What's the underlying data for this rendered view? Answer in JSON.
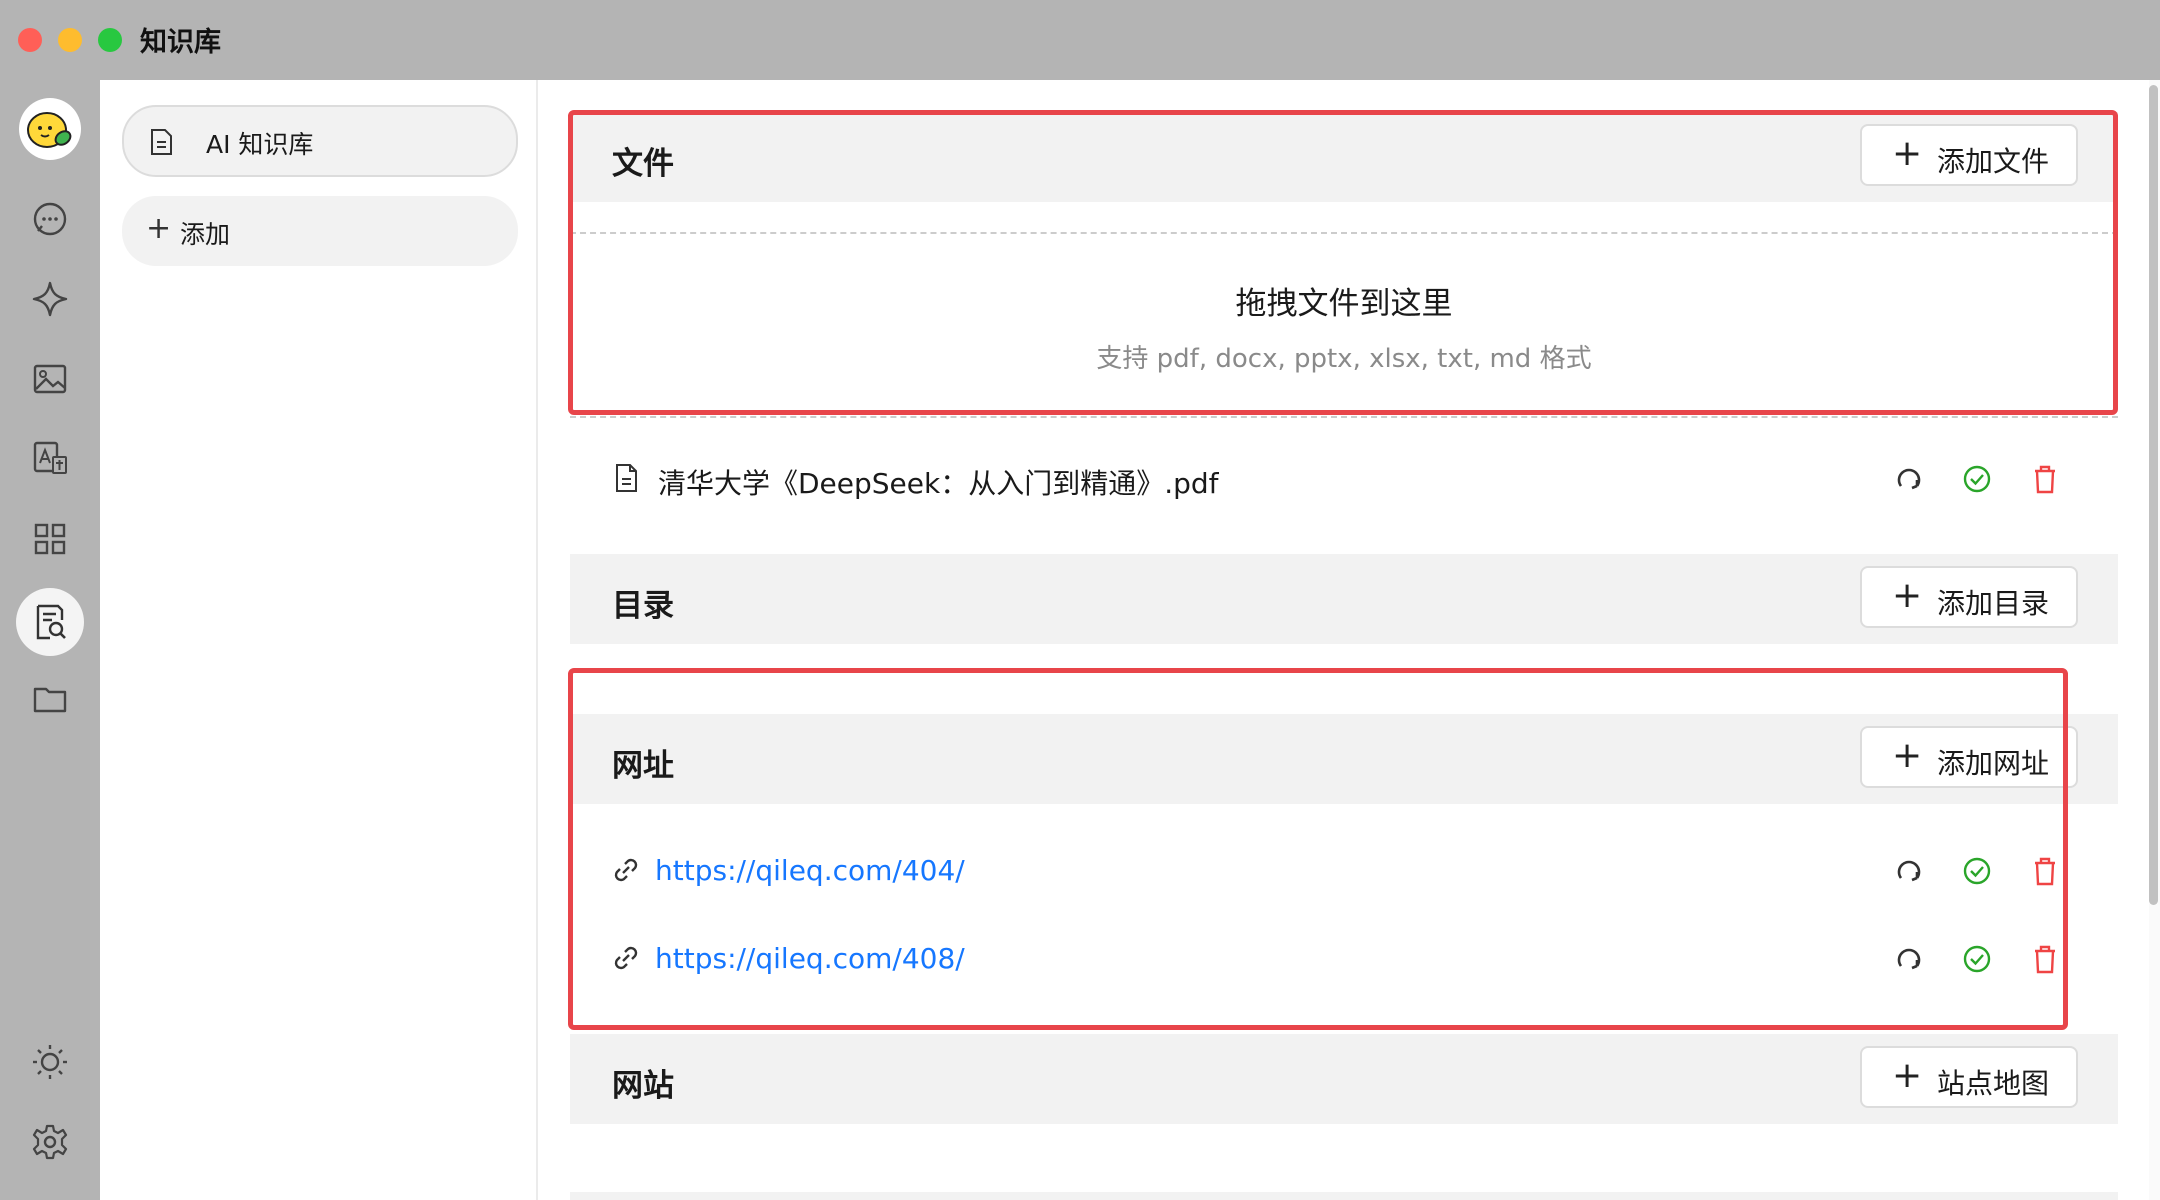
{
  "window": {
    "title": "知识库"
  },
  "sidebar_icons": [
    {
      "icon": "chat-bubble-icon"
    },
    {
      "icon": "sparkle-icon"
    },
    {
      "icon": "image-icon"
    },
    {
      "icon": "translate-icon"
    },
    {
      "icon": "apps-grid-icon"
    },
    {
      "icon": "knowledge-base-icon",
      "active": true
    },
    {
      "icon": "folder-icon"
    },
    {
      "icon": "theme-sun-icon"
    },
    {
      "icon": "settings-gear-icon"
    }
  ],
  "kb_list": {
    "items": [
      {
        "label": "AI 知识库",
        "icon": "document-icon"
      }
    ],
    "add_label": "添加"
  },
  "sections": {
    "files": {
      "title": "文件",
      "button": "添加文件",
      "drop_title": "拖拽文件到这里",
      "drop_hint": "支持 pdf, docx, pptx, xlsx, txt, md 格式",
      "items": [
        {
          "name": "清华大学《DeepSeek：从入门到精通》.pdf",
          "status": "processed"
        }
      ]
    },
    "directory": {
      "title": "目录",
      "button": "添加目录"
    },
    "urls": {
      "title": "网址",
      "button": "添加网址",
      "items": [
        {
          "url": "https://qileq.com/404/",
          "status": "processed"
        },
        {
          "url": "https://qileq.com/408/",
          "status": "processed"
        }
      ]
    },
    "website": {
      "title": "网站",
      "button": "站点地图"
    }
  },
  "colors": {
    "titlebar": "#b4b4b4",
    "highlight": "#e8454a",
    "link": "#1677ff",
    "success": "#2aa52a",
    "danger": "#ef4444"
  }
}
